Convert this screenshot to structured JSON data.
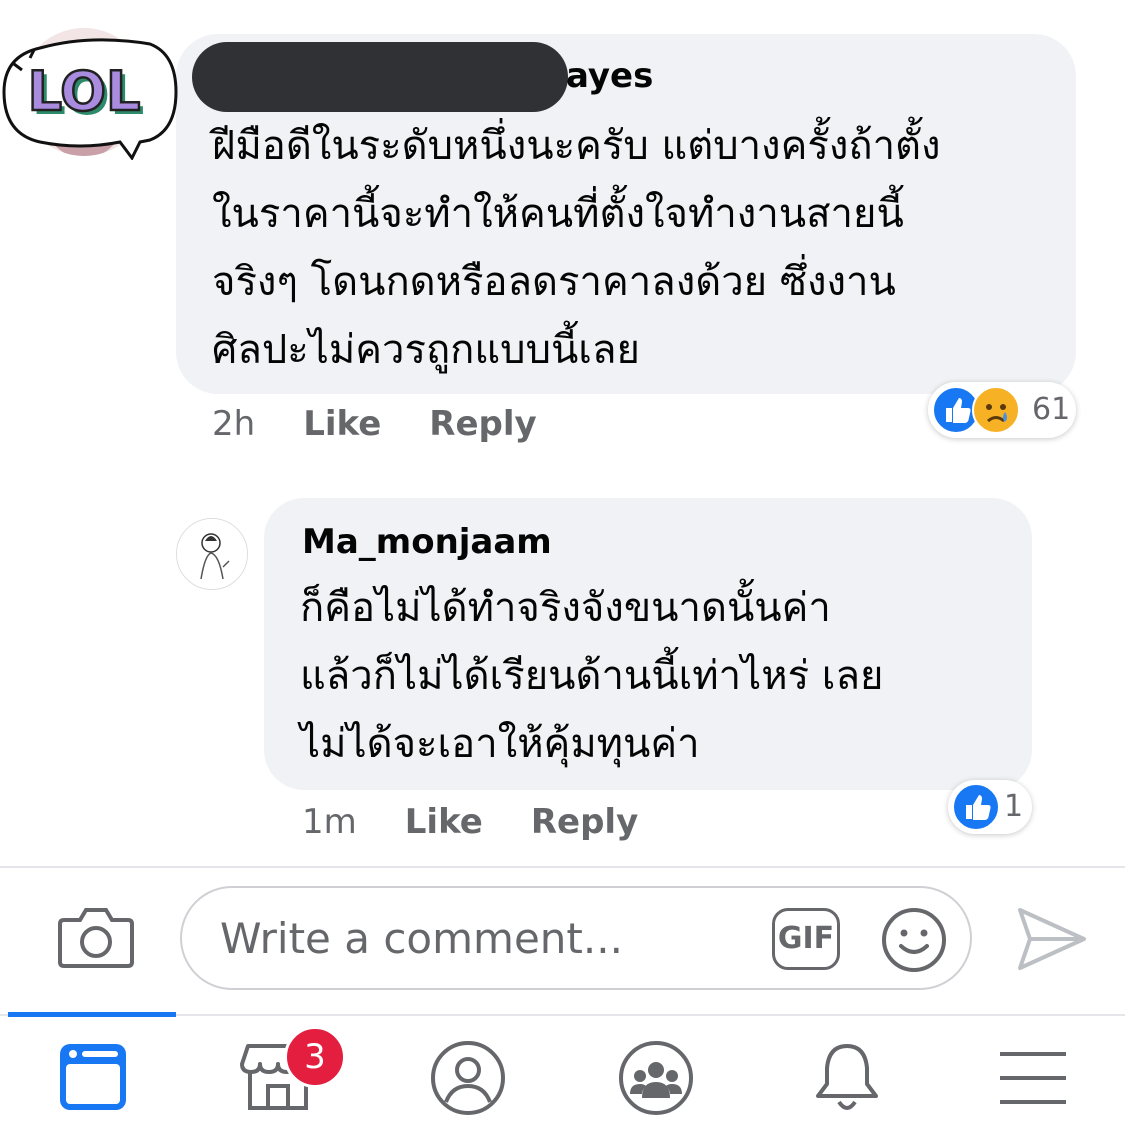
{
  "comments": [
    {
      "author": "ayes",
      "text": "ฝีมือดีในระดับหนึ่งนะครับ แต่บางครั้งถ้าตั้ง\nในราคานี้จะทำให้คนที่ตั้งใจทำงานสายนี้\nจริงๆ โดนกดหรือลดราคาลงด้วย ซึ่งงาน\nศิลปะไม่ควรถูกแบบนี้เลย",
      "time": "2h",
      "like_label": "Like",
      "reply_label": "Reply",
      "reaction_count": "61",
      "sticker_text": "LOL"
    },
    {
      "author": "Ma_monjaam",
      "text": "ก็คือไม่ได้ทำจริงจังขนาดนั้นค่า\nแล้วก็ไม่ได้เรียนด้านนี้เท่าไหร่ เลย\nไม่ได้จะเอาให้คุ้มทุนค่า",
      "time": "1m",
      "like_label": "Like",
      "reply_label": "Reply",
      "reaction_count": "1"
    }
  ],
  "composer": {
    "placeholder": "Write a comment...",
    "gif_label": "GIF",
    "icons": [
      "camera-icon",
      "gif-icon",
      "emoji-icon",
      "send-icon"
    ]
  },
  "tabbar": {
    "items": [
      "news-feed-icon",
      "marketplace-icon",
      "profile-icon",
      "groups-icon",
      "notifications-icon",
      "menu-icon"
    ],
    "active": "news-feed-icon",
    "marketplace_badge": "3"
  },
  "colors": {
    "accent": "#1877f2",
    "bubble": "#f0f2f5",
    "badge": "#e41e3f",
    "meta_text": "#65676b"
  }
}
